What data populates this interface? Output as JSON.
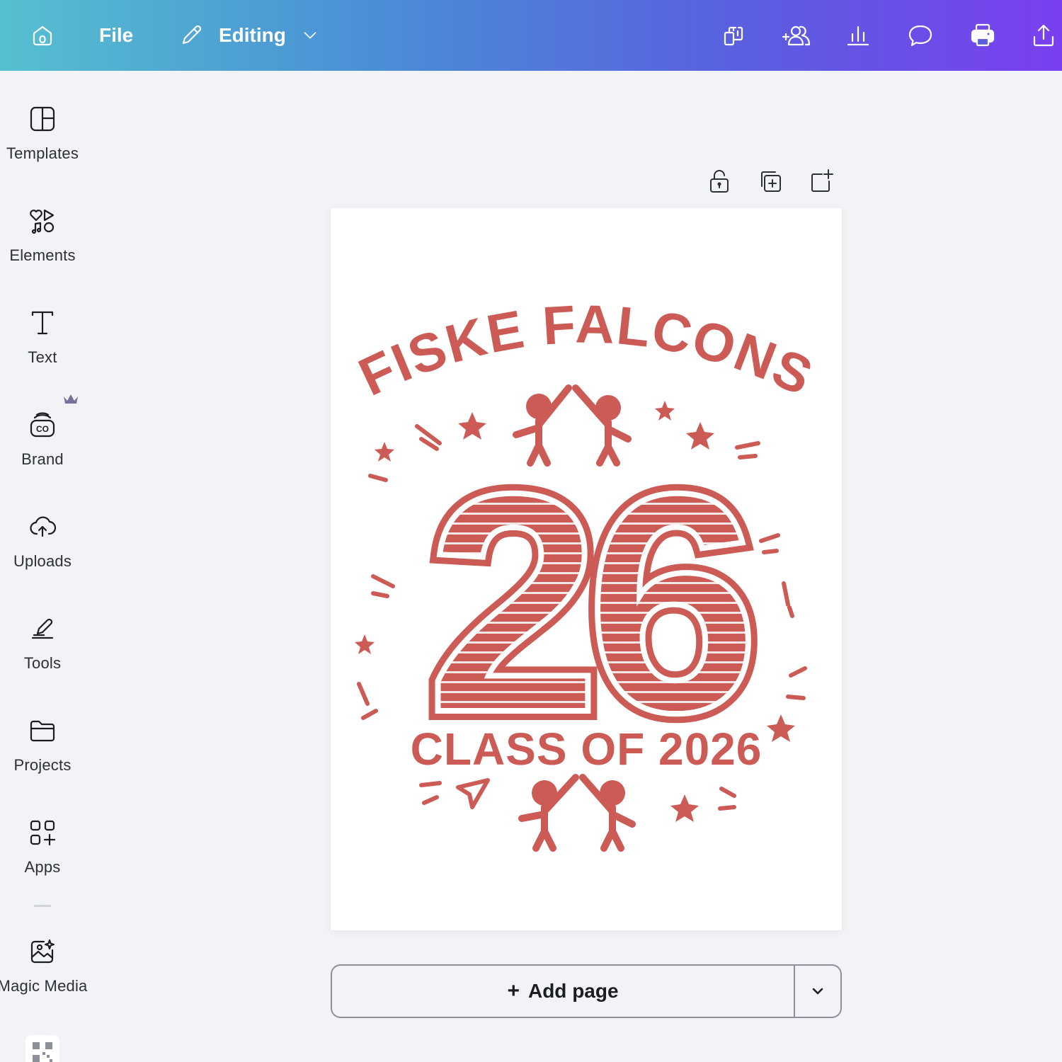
{
  "topbar": {
    "file_label": "File",
    "mode_label": "Editing",
    "icons": [
      "home-icon",
      "pencil-icon",
      "chevron-down-icon",
      "resize-icon",
      "add-people-icon",
      "insights-icon",
      "comment-icon",
      "print-icon",
      "share-icon"
    ]
  },
  "sidebar": {
    "items": [
      {
        "label": "Templates",
        "icon": "templates-icon"
      },
      {
        "label": "Elements",
        "icon": "elements-icon"
      },
      {
        "label": "Text",
        "icon": "text-icon"
      },
      {
        "label": "Brand",
        "icon": "brand-icon",
        "premium": true
      },
      {
        "label": "Uploads",
        "icon": "uploads-icon"
      },
      {
        "label": "Tools",
        "icon": "tools-icon"
      },
      {
        "label": "Projects",
        "icon": "projects-icon"
      },
      {
        "label": "Apps",
        "icon": "apps-icon"
      },
      {
        "label": "Magic Media",
        "icon": "magic-media-icon"
      }
    ]
  },
  "page_tools": {
    "icons": [
      "lock-icon",
      "duplicate-page-icon",
      "add-page-icon"
    ]
  },
  "design": {
    "top_text": "FISKE FALCONS",
    "big_number": "26",
    "bottom_text": "CLASS OF 2026",
    "color": "#cc5a55"
  },
  "add_page": {
    "label": "Add page",
    "plus": "+"
  }
}
